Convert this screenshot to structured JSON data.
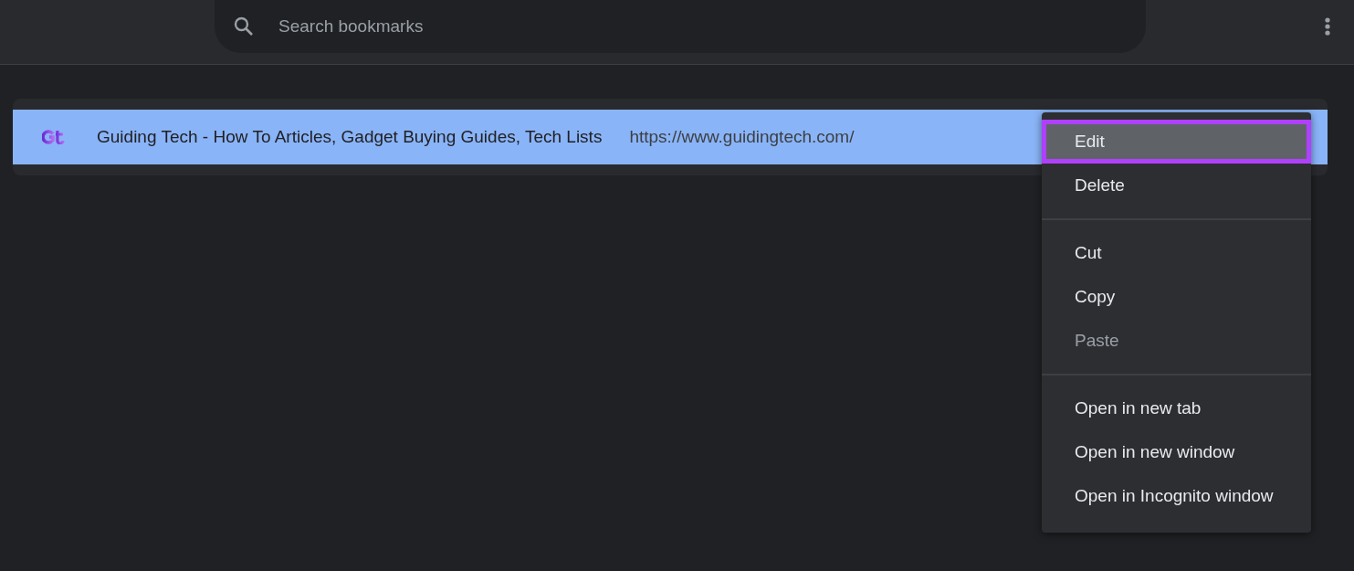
{
  "search": {
    "placeholder": "Search bookmarks"
  },
  "bookmarks": [
    {
      "title": "Guiding Tech - How To Articles, Gadget Buying Guides, Tech Lists",
      "url": "https://www.guidingtech.com/",
      "selected": true
    }
  ],
  "context_menu": {
    "sections": [
      [
        {
          "label": "Edit",
          "disabled": false,
          "highlighted": true
        },
        {
          "label": "Delete",
          "disabled": false,
          "highlighted": false
        }
      ],
      [
        {
          "label": "Cut",
          "disabled": false,
          "highlighted": false
        },
        {
          "label": "Copy",
          "disabled": false,
          "highlighted": false
        },
        {
          "label": "Paste",
          "disabled": true,
          "highlighted": false
        }
      ],
      [
        {
          "label": "Open in new tab",
          "disabled": false,
          "highlighted": false
        },
        {
          "label": "Open in new window",
          "disabled": false,
          "highlighted": false
        },
        {
          "label": "Open in Incognito window",
          "disabled": false,
          "highlighted": false
        }
      ]
    ]
  }
}
